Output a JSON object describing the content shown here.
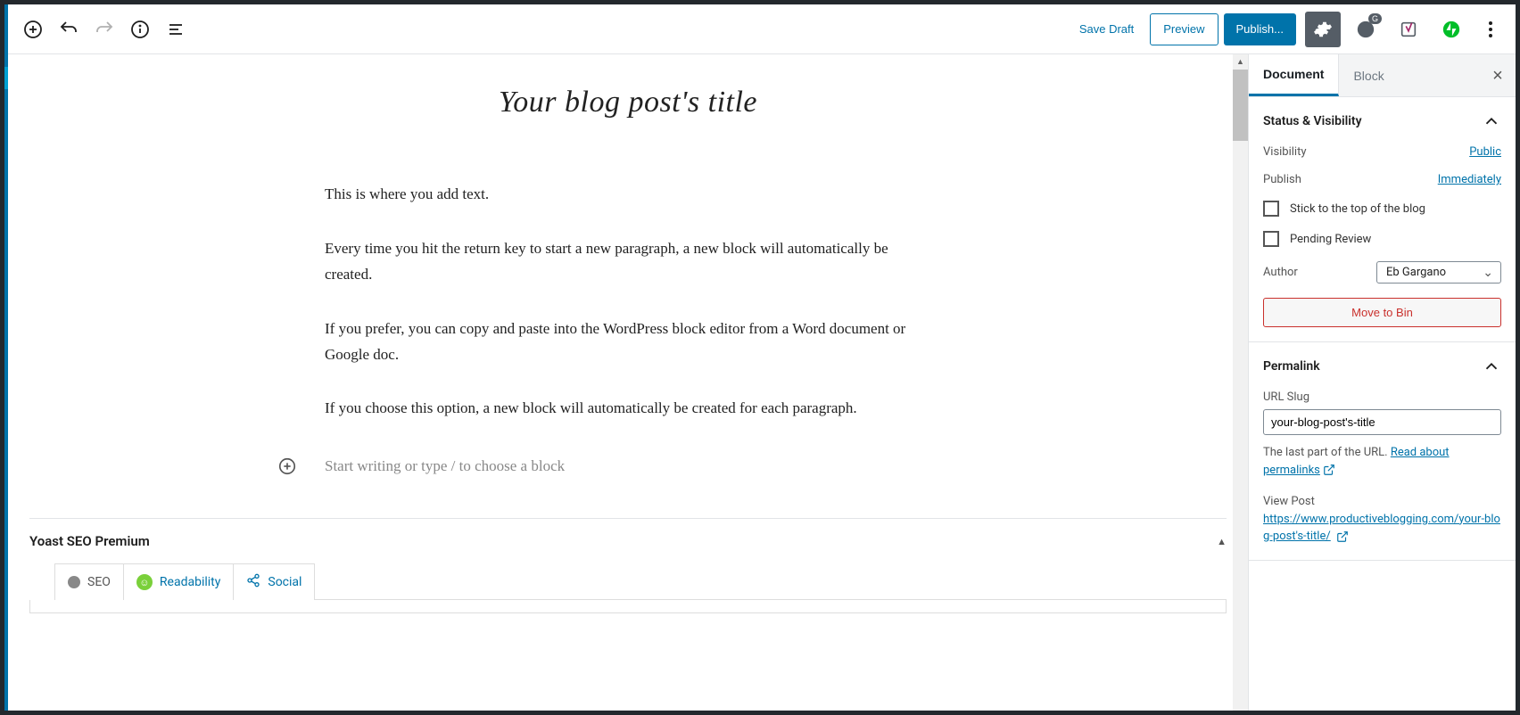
{
  "toolbar": {
    "save_draft": "Save Draft",
    "preview": "Preview",
    "publish": "Publish..."
  },
  "post": {
    "title": "Your blog post's title",
    "paragraphs": [
      "This is where you add text.",
      "Every time you hit the return key to start a new paragraph, a new block will automatically be created.",
      "If you prefer,  you can copy and paste into the WordPress block editor from a Word document or Google doc.",
      "If you choose this option, a new block will automatically be created for each paragraph."
    ],
    "placeholder": "Start writing or type / to choose a block"
  },
  "yoast": {
    "title": "Yoast SEO Premium",
    "tabs": {
      "seo": "SEO",
      "readability": "Readability",
      "social": "Social"
    }
  },
  "sidebar": {
    "tabs": {
      "document": "Document",
      "block": "Block"
    },
    "status": {
      "title": "Status & Visibility",
      "visibility_label": "Visibility",
      "visibility_value": "Public",
      "publish_label": "Publish",
      "publish_value": "Immediately",
      "stick": "Stick to the top of the blog",
      "pending": "Pending Review",
      "author_label": "Author",
      "author_value": "Eb Gargano",
      "move_to_bin": "Move to Bin"
    },
    "permalink": {
      "title": "Permalink",
      "slug_label": "URL Slug",
      "slug_value": "your-blog-post's-title",
      "help_prefix": "The last part of the URL. ",
      "help_link": "Read about permalinks",
      "view_label": "View Post",
      "view_url": "https://www.productiveblogging.com/your-blog-post's-title/"
    }
  }
}
